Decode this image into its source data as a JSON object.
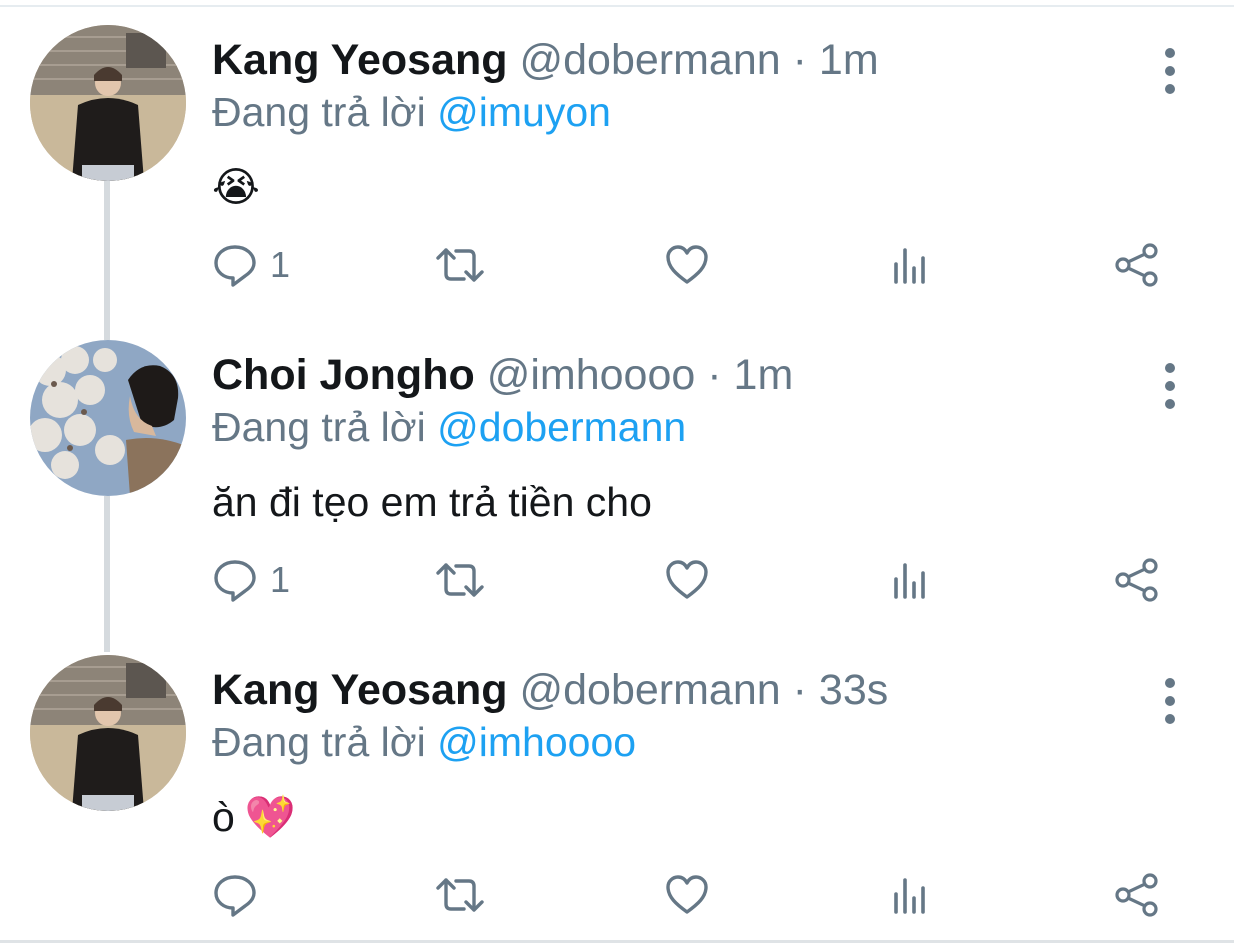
{
  "tweets": [
    {
      "name": "Kang Yeosang",
      "handle": "@dobermann",
      "separator": "·",
      "time": "1m",
      "replying_prefix": "Đang trả lời",
      "replying_to": "@imuyon",
      "text": "",
      "emoji": "😭",
      "reply_count": "1",
      "avatar": "yeosang-avatar"
    },
    {
      "name": "Choi Jongho",
      "handle": "@imhoooo",
      "separator": "·",
      "time": "1m",
      "replying_prefix": "Đang trả lời",
      "replying_to": "@dobermann",
      "text": "ăn đi tẹo em trả tiền cho",
      "emoji": "",
      "reply_count": "1",
      "avatar": "jongho-avatar"
    },
    {
      "name": "Kang Yeosang",
      "handle": "@dobermann",
      "separator": "·",
      "time": "33s",
      "replying_prefix": "Đang trả lời",
      "replying_to": "@imhoooo",
      "text": "ò",
      "emoji": "💖",
      "reply_count": "",
      "avatar": "yeosang-avatar"
    }
  ],
  "colors": {
    "text_primary": "#14171a",
    "text_secondary": "#657786",
    "link": "#1da1f2",
    "thread_line": "#d5dade"
  },
  "icons": [
    "reply-icon",
    "retweet-icon",
    "like-icon",
    "analytics-icon",
    "share-icon",
    "more-options-icon"
  ]
}
